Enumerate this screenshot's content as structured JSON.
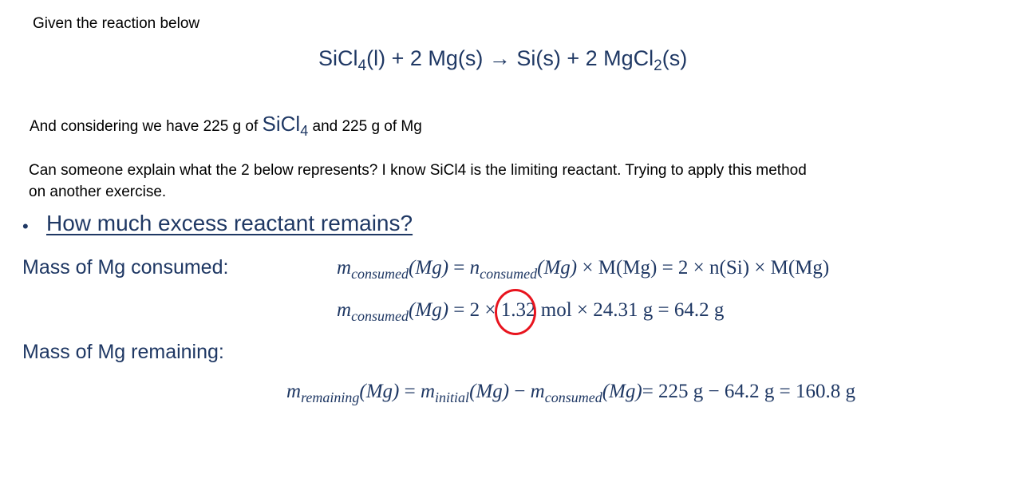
{
  "intro": "Given the reaction below",
  "reaction": {
    "reactant1": "SiCl",
    "reactant1_sub": "4",
    "reactant1_state": "(l)",
    "plus1": " + 2 Mg(s) ",
    "arrow": "→",
    "product1": " Si(s) + 2 MgCl",
    "product2_sub": "2",
    "product2_state": "(s)"
  },
  "given": {
    "prefix": "And considering we have 225 g of ",
    "formula": "SiCl",
    "formula_sub": "4",
    "suffix": " and 225 g of Mg"
  },
  "question": {
    "line1": "Can someone explain what the 2 below represents? I know SiCl4 is the limiting reactant. Trying to apply this method",
    "line2": "on another exercise."
  },
  "slide": {
    "bullet": "•",
    "heading": "How much excess reactant remains?",
    "consumed_label": "Mass of Mg consumed:",
    "remaining_label": "Mass of Mg remaining:",
    "eq1": {
      "m": "m",
      "sub": "consumed",
      "arg": "(Mg)",
      "eq": " = ",
      "n": "n",
      "nsub": "consumed",
      "narg": "(Mg)",
      "rest": " × M(Mg) = 2 × n(Si) × M(Mg)"
    },
    "eq2": {
      "m": "m",
      "sub": "consumed",
      "arg": "(Mg)",
      "eq": " = ",
      "two": "2",
      "times": " × ",
      "rest": "1.32 mol × 24.31 g = 64.2 g"
    },
    "eq3": {
      "m": "m",
      "sub": "remaining",
      "arg": "(Mg)",
      "eq": " = ",
      "m2": "m",
      "sub2": "initial",
      "arg2": "(Mg)",
      "minus": " − ",
      "m3": "m",
      "sub3": "consumed",
      "arg3": "(Mg)",
      "rest": "= 225 g − 64.2 g = 160.8 g"
    }
  },
  "annotation": {
    "color": "#e8141e",
    "target": "2"
  }
}
